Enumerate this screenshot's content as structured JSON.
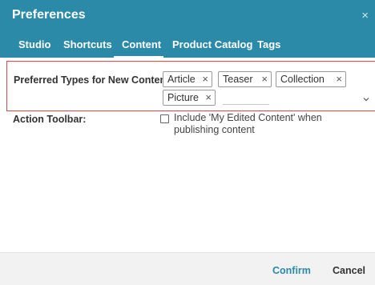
{
  "dialog": {
    "title": "Preferences",
    "close_symbol": "×"
  },
  "tabs": [
    {
      "label": "Studio"
    },
    {
      "label": "Shortcuts"
    },
    {
      "label": "Content",
      "active": true
    },
    {
      "label": "Product Catalog"
    },
    {
      "label": "Tags"
    }
  ],
  "content_types": {
    "label": "Preferred Types for New Content:",
    "chips": [
      {
        "label": "Article"
      },
      {
        "label": "Teaser"
      },
      {
        "label": "Collection"
      },
      {
        "label": "Picture"
      }
    ],
    "remove_symbol": "×",
    "input_value": ""
  },
  "action_toolbar": {
    "label": "Action Toolbar:",
    "checkbox_label": "Include 'My Edited Content' when publishing content",
    "checked": false
  },
  "footer": {
    "confirm_label": "Confirm",
    "cancel_label": "Cancel"
  },
  "colors": {
    "header_bg": "#2b8aa8",
    "focus_border": "#e0474c",
    "confirm_text": "#2b8aa8",
    "footer_bg": "#f2f2f2"
  },
  "icons": {
    "close": "close-icon",
    "chip_remove": "remove-icon",
    "dropdown": "chevron-down-icon",
    "checkbox": "checkbox-icon"
  }
}
